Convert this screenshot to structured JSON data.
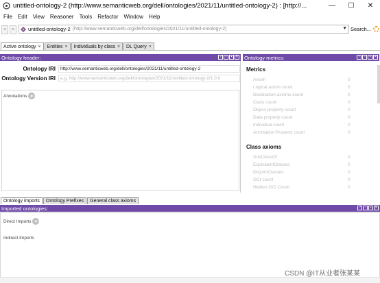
{
  "window": {
    "title": "untitled-ontology-2 (http://www.semanticweb.org/dell/ontologies/2021/11/untitled-ontology-2) : [http://...",
    "minimize": "—",
    "maximize": "☐",
    "close": "✕"
  },
  "menu": [
    "File",
    "Edit",
    "View",
    "Reasoner",
    "Tools",
    "Refactor",
    "Window",
    "Help"
  ],
  "address": {
    "back": "<",
    "forward": ">",
    "ontology_name": "untitled-ontology-2",
    "ontology_uri": "(http://www.semanticweb.org/dell/ontologies/2021/11/untitled-ontology-2)",
    "search_label": "Search..."
  },
  "tabs": [
    {
      "label": "Active ontology"
    },
    {
      "label": "Entities"
    },
    {
      "label": "Individuals by class"
    },
    {
      "label": "DL Query"
    }
  ],
  "ontology_header": {
    "title": "Ontology header:",
    "iri_label": "Ontology IRI",
    "iri_value": "http://www.semanticweb.org/dell/ontologies/2021/11/untitled-ontology-2",
    "version_label": "Ontology Version IRI",
    "version_placeholder": "e.g. http://www.semanticweb.org/dell/ontologies/2021/11/untitled-ontology-2/1.0.0",
    "annotations_label": "Annotations"
  },
  "metrics": {
    "title": "Ontology metrics:",
    "metrics_heading": "Metrics",
    "metrics_rows": [
      {
        "label": "Axiom",
        "value": "0"
      },
      {
        "label": "Logical axiom count",
        "value": "0"
      },
      {
        "label": "Declaration axioms count",
        "value": "0"
      },
      {
        "label": "Class count",
        "value": "0"
      },
      {
        "label": "Object property count",
        "value": "0"
      },
      {
        "label": "Data property count",
        "value": "0"
      },
      {
        "label": "Individual count",
        "value": "0"
      },
      {
        "label": "Annotation Property count",
        "value": "0"
      }
    ],
    "class_axioms_heading": "Class axioms",
    "class_axioms_rows": [
      {
        "label": "SubClassOf",
        "value": "0"
      },
      {
        "label": "EquivalentClasses",
        "value": "0"
      },
      {
        "label": "DisjointClasses",
        "value": "0"
      },
      {
        "label": "GCI count",
        "value": "0"
      },
      {
        "label": "Hidden GCI Count",
        "value": "0"
      }
    ]
  },
  "lower_tabs": [
    {
      "label": "Ontology imports"
    },
    {
      "label": "Ontology Prefixes"
    },
    {
      "label": "General class axioms"
    }
  ],
  "imports": {
    "title": "Imported ontologies:",
    "direct_label": "Direct Imports",
    "indirect_label": "Indirect Imports"
  },
  "watermark": "CSDN @IT从业者张某某",
  "colors": {
    "panel_header": "#6f4aa6",
    "spinner": "#f39c1f"
  }
}
